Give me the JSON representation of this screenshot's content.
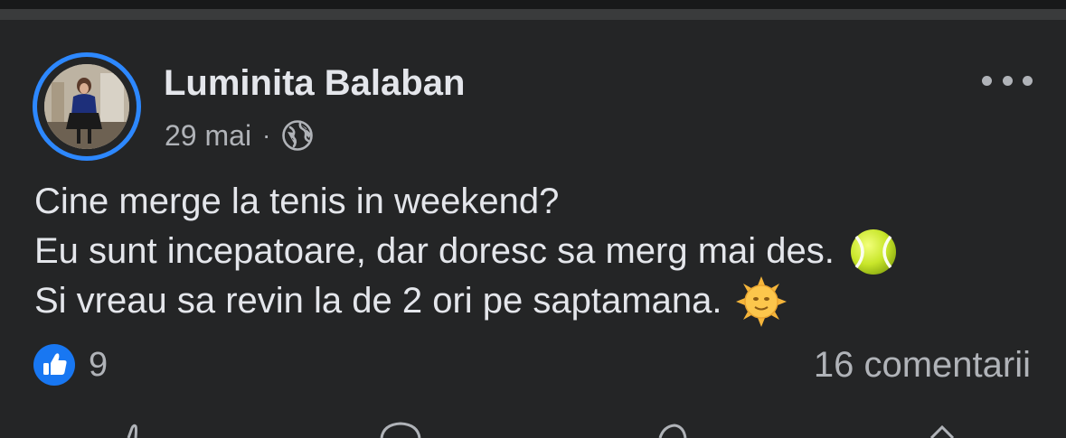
{
  "post": {
    "author": {
      "name": "Luminita Balaban"
    },
    "meta": {
      "date": "29 mai",
      "separator": "·",
      "audience_icon": "globe-icon"
    },
    "menu_icon": "more-options-icon",
    "text_lines": [
      {
        "text": "Cine merge la tenis in weekend?",
        "emoji": ""
      },
      {
        "text": "Eu sunt incepatoare, dar doresc sa merg mai des.",
        "emoji": "tennis-ball-icon"
      },
      {
        "text": "Si vreau sa revin la de 2 ori pe saptamana.",
        "emoji": "sun-face-icon"
      }
    ],
    "reactions": {
      "icon": "like-icon",
      "count": "9"
    },
    "comments_label": "16 comentarii",
    "actions": [
      "like-action-icon",
      "comment-action-icon",
      "message-action-icon",
      "share-action-icon"
    ]
  },
  "colors": {
    "background": "#242526",
    "divider": "#3a3b3c",
    "primary_text": "#e4e6eb",
    "secondary_text": "#b0b3b8",
    "accent_blue": "#2d88ff"
  }
}
